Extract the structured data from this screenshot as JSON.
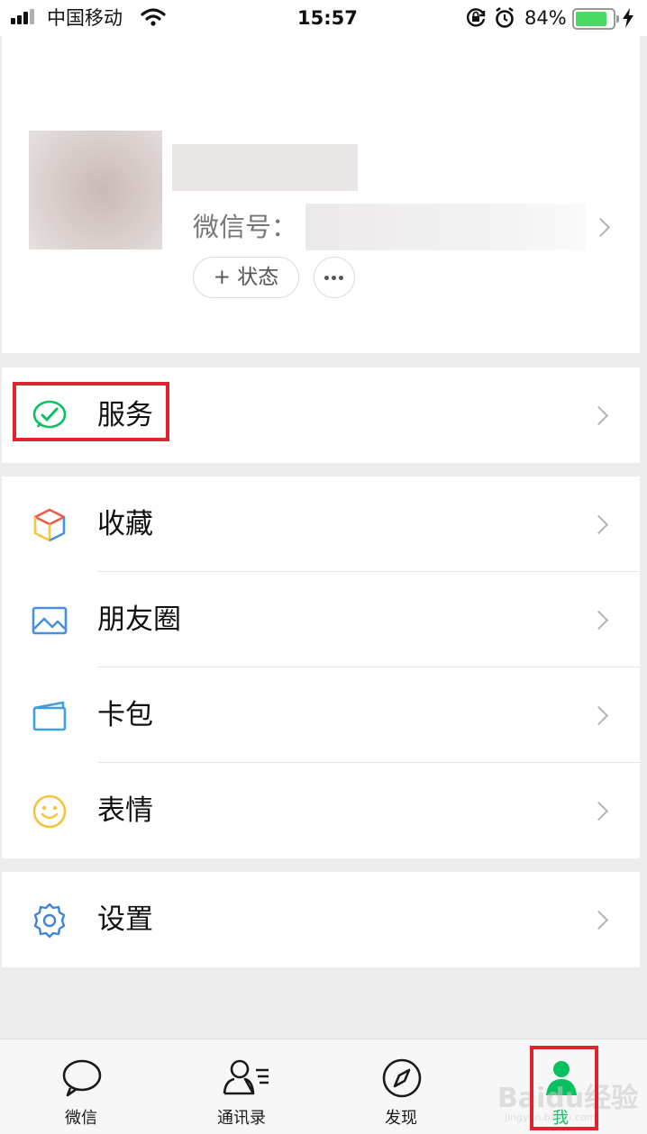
{
  "status_bar": {
    "carrier": "中国移动",
    "time": "15:57",
    "battery_percent": "84%",
    "battery_level": 0.84
  },
  "profile": {
    "wxid_label": "微信号：",
    "status_button": "+ 状态"
  },
  "menu": {
    "service": "服务",
    "favorites": "收藏",
    "moments": "朋友圈",
    "cards": "卡包",
    "stickers": "表情",
    "settings": "设置"
  },
  "tabs": [
    {
      "label": "微信"
    },
    {
      "label": "通讯录"
    },
    {
      "label": "发现"
    },
    {
      "label": "我",
      "active": true
    }
  ],
  "watermark": {
    "brand": "Baidu经验",
    "url": "jingyan.baidu.com"
  },
  "colors": {
    "accent": "#07c160",
    "highlight_box": "#e0242f",
    "chevron": "#b3b3b3"
  }
}
